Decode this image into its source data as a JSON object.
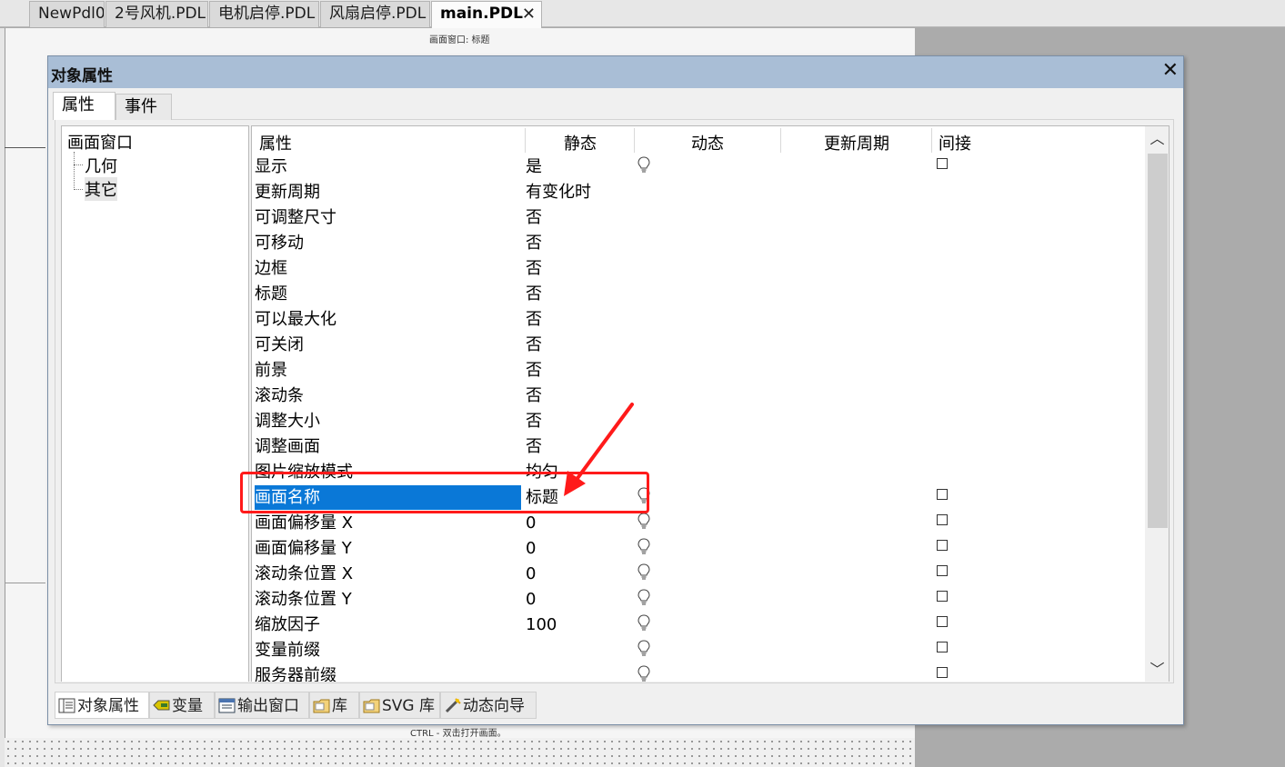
{
  "doc_tabs": [
    {
      "label": "NewPdl0"
    },
    {
      "label": "2号风机.PDL"
    },
    {
      "label": "电机启停.PDL"
    },
    {
      "label": "风扇启停.PDL"
    },
    {
      "label": "main.PDL",
      "active": true
    }
  ],
  "canvas": {
    "title": "画面窗口: 标题",
    "footer": "CTRL - 双击打开画面。"
  },
  "dialog": {
    "title": "对象属性",
    "tabs": [
      "属性",
      "事件"
    ],
    "tree": {
      "root": "画面窗口",
      "children": [
        "几何",
        "其它"
      ]
    },
    "columns": [
      "属性",
      "静态",
      "动态",
      "更新周期",
      "间接"
    ],
    "rows": [
      {
        "name": "显示",
        "static": "是",
        "bulb": true,
        "check": true
      },
      {
        "name": "更新周期",
        "static": "有变化时",
        "bulb": false,
        "check": false
      },
      {
        "name": "可调整尺寸",
        "static": "否",
        "bulb": false,
        "check": false
      },
      {
        "name": "可移动",
        "static": "否",
        "bulb": false,
        "check": false
      },
      {
        "name": "边框",
        "static": "否",
        "bulb": false,
        "check": false
      },
      {
        "name": "标题",
        "static": "否",
        "bulb": false,
        "check": false
      },
      {
        "name": "可以最大化",
        "static": "否",
        "bulb": false,
        "check": false
      },
      {
        "name": "可关闭",
        "static": "否",
        "bulb": false,
        "check": false
      },
      {
        "name": "前景",
        "static": "否",
        "bulb": false,
        "check": false
      },
      {
        "name": "滚动条",
        "static": "否",
        "bulb": false,
        "check": false
      },
      {
        "name": "调整大小",
        "static": "否",
        "bulb": false,
        "check": false
      },
      {
        "name": "调整画面",
        "static": "否",
        "bulb": false,
        "check": false
      },
      {
        "name": "图片缩放模式",
        "static": "均匀",
        "bulb": false,
        "check": false
      },
      {
        "name": "画面名称",
        "static": "标题",
        "bulb": true,
        "check": true,
        "selected": true
      },
      {
        "name": "画面偏移量 X",
        "static": "0",
        "bulb": true,
        "check": true
      },
      {
        "name": "画面偏移量 Y",
        "static": "0",
        "bulb": true,
        "check": true
      },
      {
        "name": "滚动条位置 X",
        "static": "0",
        "bulb": true,
        "check": true
      },
      {
        "name": "滚动条位置 Y",
        "static": "0",
        "bulb": true,
        "check": true
      },
      {
        "name": "缩放因子",
        "static": "100",
        "bulb": true,
        "check": true
      },
      {
        "name": "变量前缀",
        "static": "",
        "bulb": true,
        "check": true
      },
      {
        "name": "服务器前缀",
        "static": "",
        "bulb": true,
        "check": true
      }
    ],
    "bottom_tabs": [
      {
        "label": "对象属性",
        "icon": "properties-icon",
        "active": true
      },
      {
        "label": "变量",
        "icon": "tag-icon"
      },
      {
        "label": "输出窗口",
        "icon": "output-window-icon"
      },
      {
        "label": "库",
        "icon": "folder-icon"
      },
      {
        "label": "SVG 库",
        "icon": "folder-icon"
      },
      {
        "label": "动态向导",
        "icon": "wand-icon"
      }
    ]
  },
  "colors": {
    "selection": "#0a78d7",
    "annotation": "#ff1a1a",
    "titlebar": "#a9bed6"
  }
}
